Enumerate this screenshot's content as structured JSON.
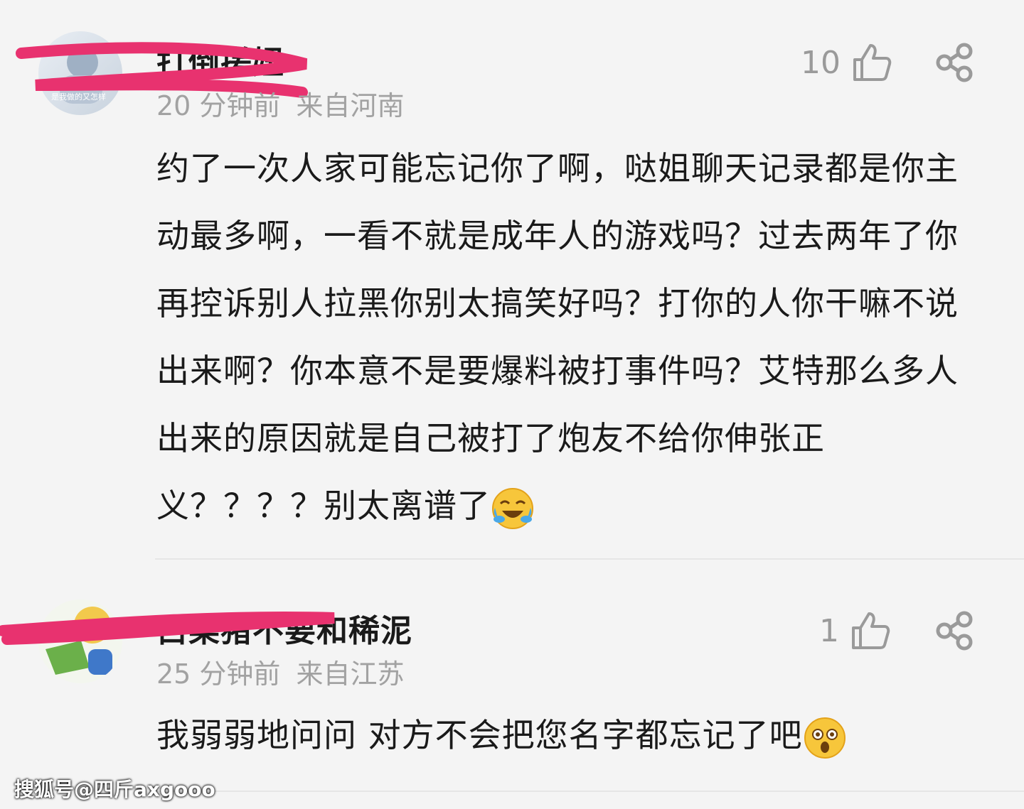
{
  "comments": [
    {
      "username": "打倒搓妞",
      "avatar_caption": "是我做的又怎样",
      "time": "20 分钟前",
      "location": "来自河南",
      "likes": "10",
      "text": "约了一次人家可能忘记你了啊，哒姐聊天记录都是你主动最多啊，一看不就是成年人的游戏吗？过去两年了你再控诉别人拉黑你别太搞笑好吗？打你的人你干嘛不说出来啊？你本意不是要爆料被打事件吗？艾特那么多人出来的原因就是自己被打了炮友不给你伸张正义？？？？别太离谱了",
      "emoji": "laughing-crying-emoji"
    },
    {
      "username": "白菜猪不要和稀泥",
      "time": "25 分钟前",
      "location": "来自江苏",
      "likes": "1",
      "text": "我弱弱地问问 对方不会把您名字都忘记了吧",
      "emoji": "shocked-emoji"
    }
  ],
  "watermark": "搜狐号@四斤axgooo",
  "colors": {
    "background": "#f4f4f4",
    "meta": "#a2a2a2",
    "redaction": "#e8326f"
  }
}
